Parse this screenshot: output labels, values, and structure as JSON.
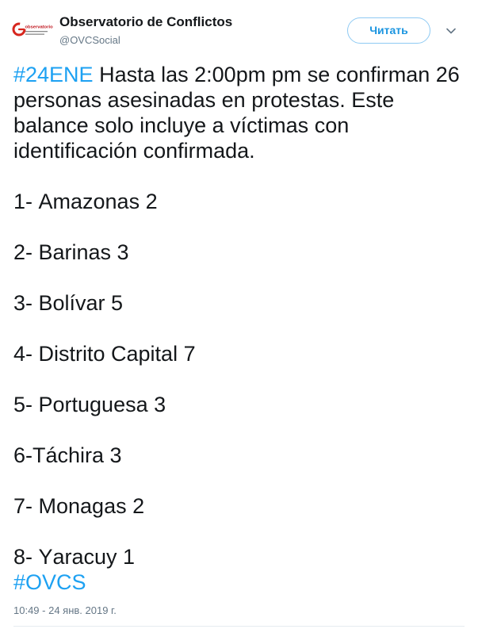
{
  "tweet": {
    "author": {
      "name": "Observatorio de Conflictos",
      "handle": "@OVCSocial",
      "avatar_icon": "observatorio-logo-icon",
      "logo_text": "observatorio"
    },
    "follow_button_label": "Читать",
    "menu_icon": "chevron-down-icon",
    "intro": {
      "hashtag": "#24ENE",
      "text": "Hasta las 2:00pm pm se confirman 26 personas asesinadas en protestas. Este balance solo incluye a víctimas con identificación confirmada."
    },
    "list_items": [
      "1- Amazonas 2",
      "2- Barinas 3",
      "3- Bolívar 5",
      "4- Distrito Capital 7",
      "5- Portuguesa 3",
      "6-Táchira 3",
      "7- Monagas 2",
      "8- Yaracuy 1"
    ],
    "closing_hashtag": "#OVCS",
    "timestamp": "10:49 - 24 янв. 2019 г."
  },
  "colors": {
    "text": "#14171a",
    "link": "#1da1f2",
    "muted": "#657786",
    "logo_red": "#d7261e"
  }
}
